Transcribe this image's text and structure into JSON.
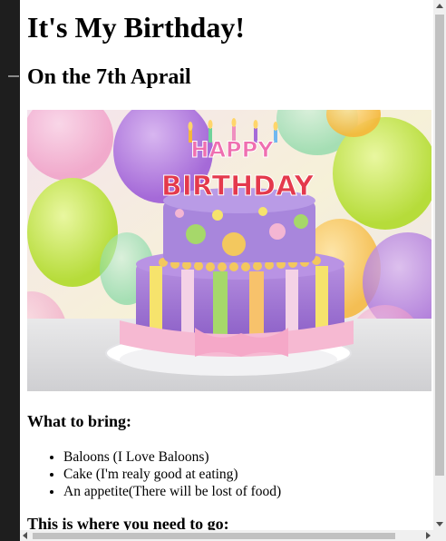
{
  "page": {
    "title": "It's My Birthday!",
    "subtitle": "On the 7th Aprail",
    "bring_heading": "What to bring:",
    "bring_items": [
      "Baloons (I Love Baloons)",
      "Cake (I'm realy good at eating)",
      "An appetite(There will be lost of food)"
    ],
    "location_heading": "This is where you need to go:"
  },
  "hero_image": {
    "cake_text_line1": "HAPPY",
    "cake_text_line2": "BIRTHDAY"
  },
  "colors": {
    "page_background": "#ffffff",
    "left_panel": "#1e1e1e",
    "scrollbar_track": "#f0f0f0",
    "scrollbar_thumb": "#c1c1c1"
  }
}
